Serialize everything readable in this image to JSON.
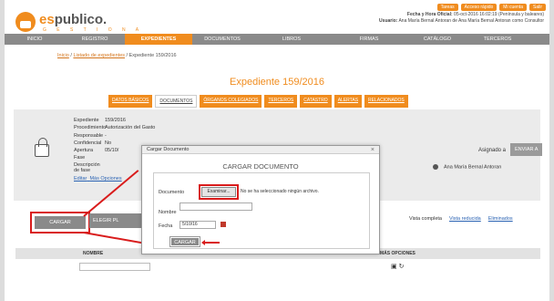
{
  "brand": {
    "name_prefix": "es",
    "name_rest": "publico.",
    "sub": "G E S T I O N A"
  },
  "toplinks": [
    "Tareas",
    "Acceso rápido",
    "Mi cuenta",
    "Salir"
  ],
  "header": {
    "fecha_label": "Fecha y Hora Oficial:",
    "fecha_value": "05-oct-2016 16:02:19 (Península y baleares)",
    "usuario_label": "Usuario:",
    "usuario_value": "Ana María Bernal Antoran de Ana María Bernal Antoran como Consultor"
  },
  "nav": [
    "INICIO",
    "REGISTRO",
    "EXPEDIENTES",
    "DOCUMENTOS",
    "LIBROS",
    "FIRMAS",
    "CATÁLOGO",
    "TERCEROS"
  ],
  "breadcrumb": {
    "link1": "Inicio",
    "sep1": " / ",
    "link2": "Listado de expedientes",
    "current": " / Expediente 159/2016"
  },
  "title": "Expediente 159/2016",
  "tabs": [
    "DATOS BÁSICOS",
    "DOCUMENTOS",
    "ÓRGANOS COLEGIADOS",
    "TERCEROS",
    "CATASTRO",
    "ALERTAS",
    "RELACIONADOS"
  ],
  "fields": [
    {
      "label": "Expediente",
      "value": "159/2016"
    },
    {
      "label": "Procedimiento",
      "value": "Autorización del Gasto"
    },
    {
      "label": "Responsable",
      "value": "-"
    },
    {
      "label": "Confidencial",
      "value": "No"
    },
    {
      "label": "Apertura",
      "value": "05/10/"
    },
    {
      "label": "Fase",
      "value": ""
    },
    {
      "label": "Descripción de fase",
      "value": ""
    }
  ],
  "field_links": {
    "edit": "Editar",
    "more": "Más Opciones"
  },
  "asignado": "Asignado a",
  "enviar": "ENVIAR A",
  "person": "Ana María Bernal Antoran",
  "buttons": {
    "cargar": "CARGAR DOCUMENTO",
    "elegir": "ELEGIR PL"
  },
  "view_links": {
    "completa": "Vista completa",
    "reducida": "Vista reducida",
    "eliminados": "Eliminados"
  },
  "table": {
    "nombre": "NOMBRE",
    "mas": "MÁS OPCIONES"
  },
  "modal": {
    "bar_title": "Cargar Documento",
    "close": "×",
    "title": "CARGAR DOCUMENTO",
    "documento_label": "Documento",
    "examinar": "Examinar...",
    "no_file": "No se ha seleccionado ningún archivo.",
    "nombre_label": "Nombre",
    "nombre_value": "",
    "fecha_label": "Fecha",
    "fecha_value": "5/10/16",
    "submit": "CARGAR"
  },
  "colors": {
    "accent": "#f08c1e",
    "nav": "#8a8a8a",
    "highlight": "#d91c1c"
  }
}
